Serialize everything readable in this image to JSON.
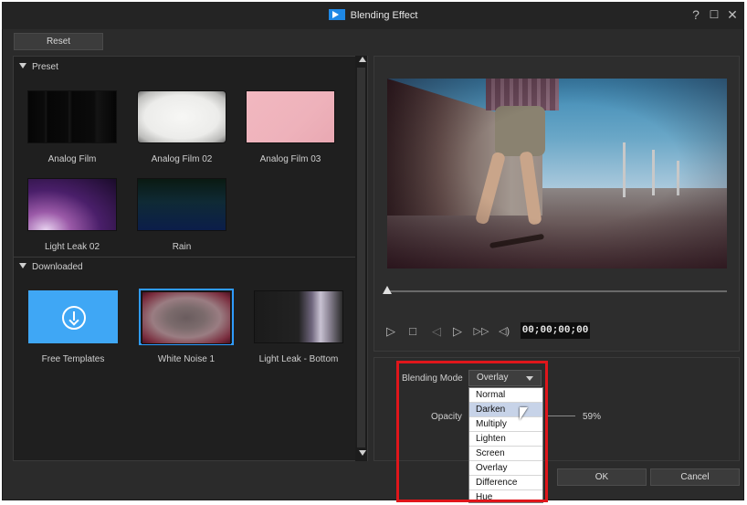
{
  "window": {
    "title": "Blending Effect",
    "help_glyph": "?",
    "maximize_glyph": "☐",
    "close_glyph": "✕"
  },
  "toolbar": {
    "reset_label": "Reset"
  },
  "library": {
    "preset": {
      "header": "Preset",
      "items": [
        {
          "label": "Analog Film"
        },
        {
          "label": "Analog Film 02"
        },
        {
          "label": "Analog Film 03"
        },
        {
          "label": "Light Leak 02"
        },
        {
          "label": "Rain"
        }
      ]
    },
    "downloaded": {
      "header": "Downloaded",
      "items": [
        {
          "label": "Free Templates",
          "icon": "download-icon"
        },
        {
          "label": "White Noise 1",
          "selected": true
        },
        {
          "label": "Light Leak - Bottom"
        }
      ]
    }
  },
  "player": {
    "timecode": "00;00;00;00",
    "controls": {
      "play": "▷",
      "stop": "□",
      "prev_frame": "◁",
      "next_frame": "▷",
      "fast_forward": "▷▷",
      "volume": "◁)"
    },
    "position": 0
  },
  "settings": {
    "blending_mode_label": "Blending Mode",
    "blending_mode_value": "Overlay",
    "opacity_label": "Opacity",
    "opacity_value": "59%",
    "blend_options": [
      "Normal",
      "Darken",
      "Multiply",
      "Lighten",
      "Screen",
      "Overlay",
      "Difference",
      "Hue"
    ],
    "hovered_option": "Darken"
  },
  "footer": {
    "ok_label": "OK",
    "cancel_label": "Cancel"
  },
  "colors": {
    "selection": "#2f9bff",
    "highlight_annotation": "#e0161b",
    "dropdown_hover": "#c7d3e8"
  }
}
